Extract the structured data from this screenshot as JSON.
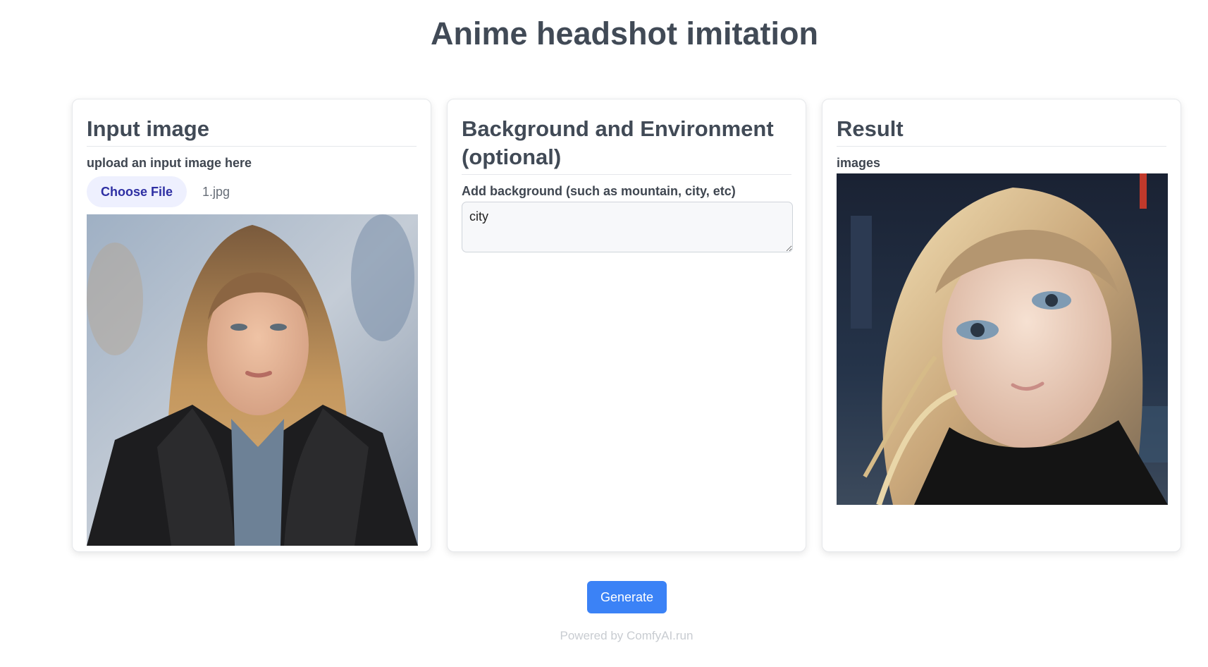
{
  "page": {
    "title": "Anime headshot imitation"
  },
  "input_card": {
    "title": "Input image",
    "label": "upload an input image here",
    "choose_file_label": "Choose File",
    "file_name": "1.jpg"
  },
  "background_card": {
    "title": "Background and Environment (optional)",
    "label": "Add background (such as mountain, city, etc)",
    "value": "city"
  },
  "result_card": {
    "title": "Result",
    "label": "images"
  },
  "actions": {
    "generate_label": "Generate"
  },
  "footer": {
    "prefix": "Powered by ",
    "link_text": "ComfyAI.run"
  },
  "colors": {
    "primary": "#3b82f6",
    "choose_bg": "#eef0fe",
    "choose_text": "#2e2fa3"
  }
}
